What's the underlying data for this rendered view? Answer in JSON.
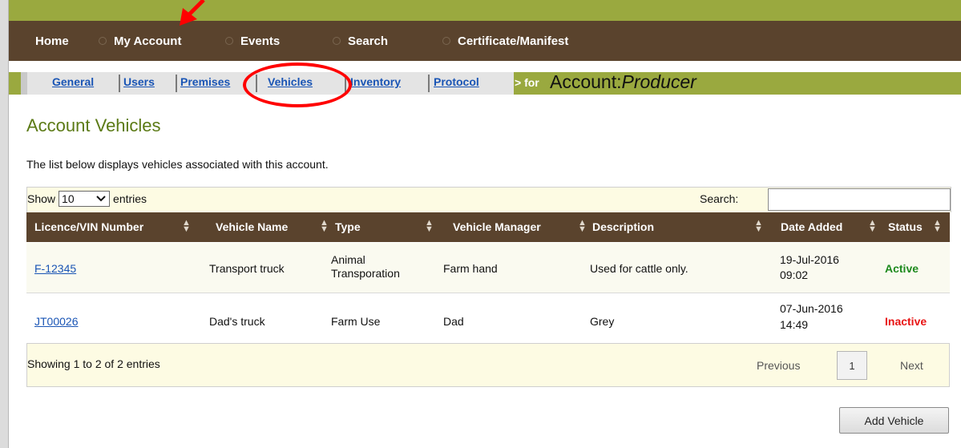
{
  "nav": {
    "items": [
      "Home",
      "My Account",
      "Events",
      "Search",
      "Certificate/Manifest"
    ]
  },
  "subnav": {
    "tabs": [
      "General",
      "Users",
      "Premises",
      "Vehicles",
      "Inventory",
      "Protocol"
    ],
    "for_prefix": "> for",
    "account_label": "Account:",
    "account_name": "Producer"
  },
  "page": {
    "title": "Account Vehicles",
    "description": "The list below displays vehicles associated with this account."
  },
  "controls": {
    "show_label": "Show",
    "entries_value": "10",
    "entries_label": "entries",
    "search_label": "Search:",
    "search_value": ""
  },
  "table": {
    "headers": [
      "Licence/VIN Number",
      "Vehicle Name",
      "Type",
      "Vehicle Manager",
      "Description",
      "Date Added",
      "Status"
    ],
    "rows": [
      {
        "licence": "F-12345",
        "name": "Transport truck",
        "type_line1": "Animal",
        "type_line2": "Transporation",
        "manager": "Farm hand",
        "description": "Used for cattle only.",
        "date_line1": "19-Jul-2016",
        "date_line2": "09:02",
        "status": "Active"
      },
      {
        "licence": "JT00026",
        "name": "Dad's truck",
        "type_line1": "Farm Use",
        "type_line2": "",
        "manager": "Dad",
        "description": "Grey",
        "date_line1": "07-Jun-2016",
        "date_line2": "14:49",
        "status": "Inactive"
      }
    ]
  },
  "pagination": {
    "info": "Showing 1 to 2 of 2 entries",
    "previous": "Previous",
    "page": "1",
    "next": "Next"
  },
  "actions": {
    "add_vehicle": "Add Vehicle"
  },
  "colors": {
    "nav_bg": "#5a432d",
    "accent_green": "#9aa93f",
    "title_green": "#5b7a15",
    "link_blue": "#1a55b5",
    "active": "#1e8a1e",
    "inactive": "#e81414",
    "annotation_red": "#ff0000"
  }
}
